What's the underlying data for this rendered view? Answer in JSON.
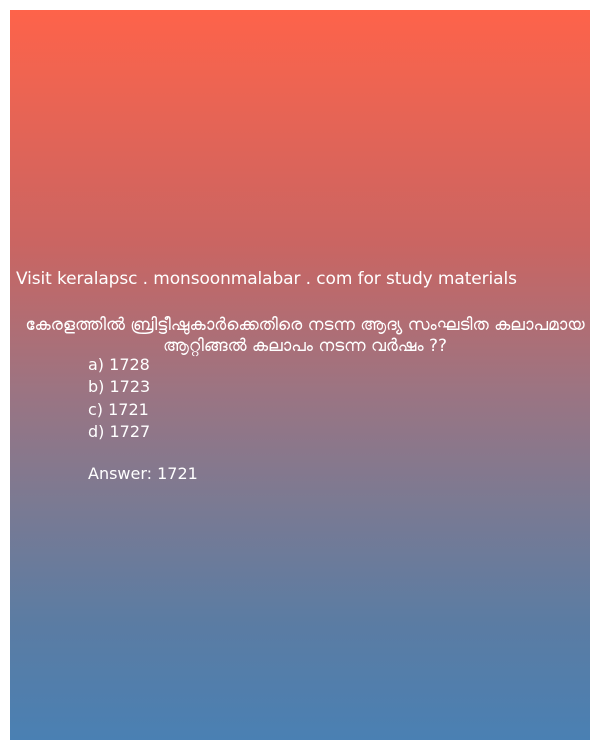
{
  "background": {
    "gradient_top": "#fe634a",
    "gradient_bottom": "#4a80b3",
    "text_color": "#ffffff"
  },
  "site_line": "Visit keralapsc . monsoonmalabar . com for study materials",
  "question": "കേരളത്തിൽ ബ്രിട്ടീഷുകാർക്കെതിരെ നടന്ന ആദ്യ സംഘടിത കലാപമായ ആറ്റിങ്ങൽ കലാപം നടന്ന വർഷം ??",
  "options": [
    "a) 1728",
    "b) 1723",
    "c) 1721",
    "d) 1727"
  ],
  "answer": "Answer: 1721"
}
